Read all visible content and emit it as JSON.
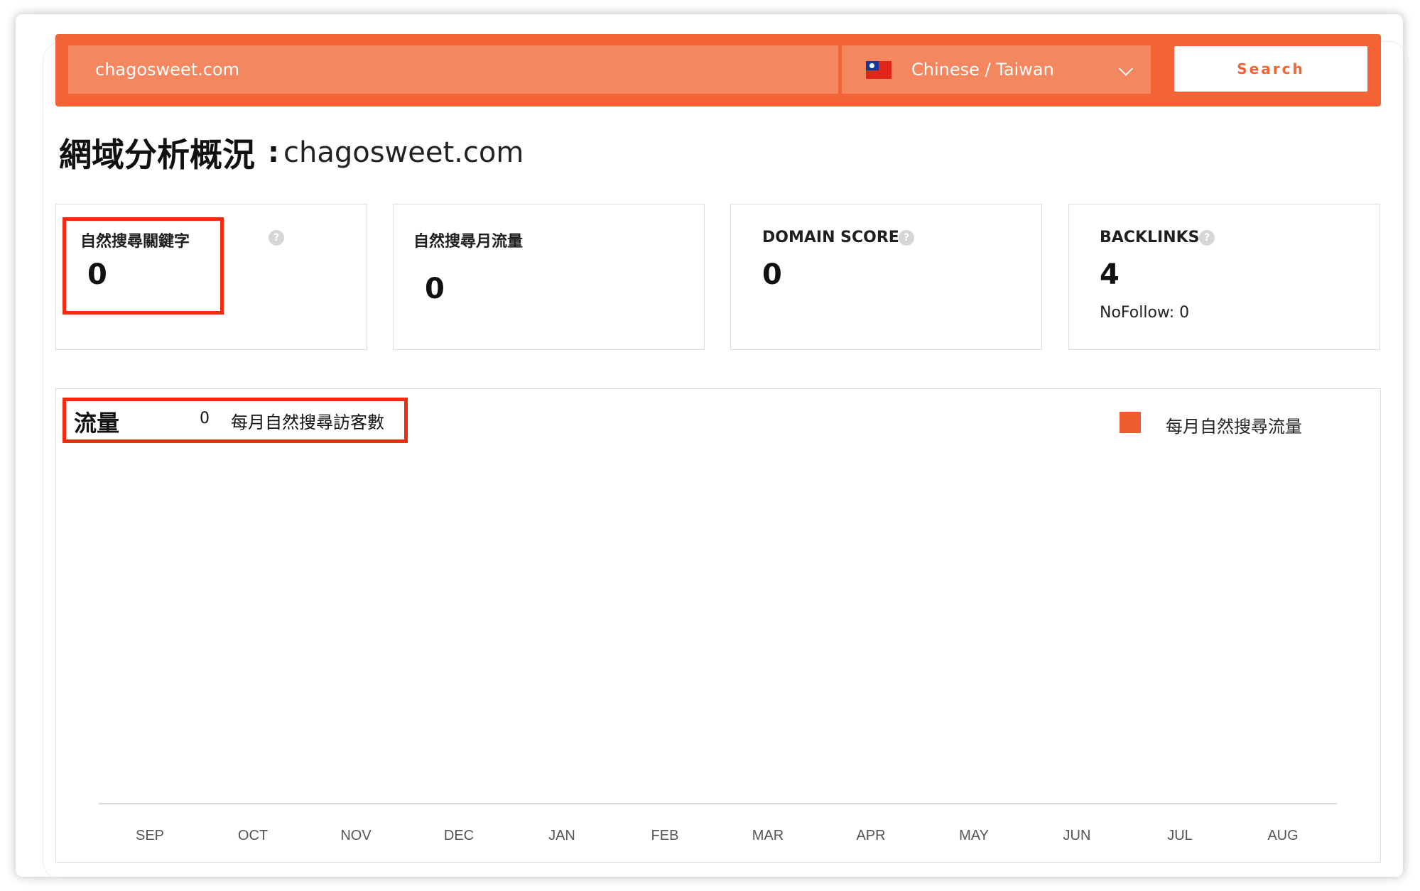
{
  "search": {
    "domain_value": "chagosweet.com",
    "language_label": "Chinese / Taiwan",
    "button_label": "Search"
  },
  "page": {
    "title_cn": "網域分析概況",
    "title_colon": ":",
    "title_domain": "chagosweet.com"
  },
  "cards": {
    "organic_keywords": {
      "label": "自然搜尋關鍵字",
      "value": "0",
      "help": "?"
    },
    "monthly_traffic": {
      "label": "自然搜尋月流量",
      "value": "0"
    },
    "domain_score": {
      "label": "DOMAIN SCORE",
      "value": "0",
      "help": "?"
    },
    "backlinks": {
      "label": "BACKLINKS",
      "value": "4",
      "nofollow": "NoFollow: 0",
      "help": "?"
    }
  },
  "traffic": {
    "title": "流量",
    "count": "0",
    "description": "每月自然搜尋訪客數",
    "legend_label": "每月自然搜尋流量"
  },
  "colors": {
    "accent": "#f26335",
    "highlight": "#f22c0f",
    "legend": "#ee5c30"
  },
  "chart_data": {
    "type": "bar",
    "categories": [
      "SEP",
      "OCT",
      "NOV",
      "DEC",
      "JAN",
      "FEB",
      "MAR",
      "APR",
      "MAY",
      "JUN",
      "JUL",
      "AUG"
    ],
    "series": [
      {
        "name": "每月自然搜尋流量",
        "values": [
          0,
          0,
          0,
          0,
          0,
          0,
          0,
          0,
          0,
          0,
          0,
          0
        ]
      }
    ],
    "legend": "top-right",
    "grid": false
  }
}
